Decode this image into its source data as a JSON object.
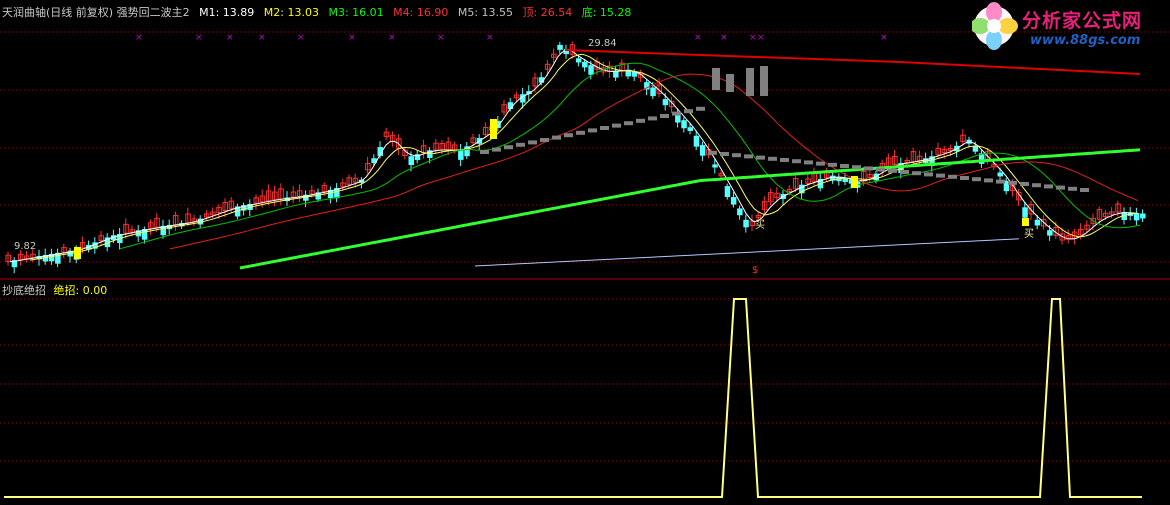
{
  "main_panel": {
    "indicator_name": "天润曲轴(日线 前复权) 强势回二波主2",
    "ma": [
      {
        "label": "M1: 13.89",
        "color": "#ffffff"
      },
      {
        "label": "M2: 13.03",
        "color": "#ffff00"
      },
      {
        "label": "M3: 16.01",
        "color": "#00ff00"
      },
      {
        "label": "M4: 16.90",
        "color": "#ff3030"
      },
      {
        "label": "M5: 13.55",
        "color": "#c0c0c0"
      }
    ],
    "top": {
      "label": "顶: 26.54",
      "color": "#ff3030"
    },
    "bottom": {
      "label": "底: 15.28",
      "color": "#00ff00"
    },
    "high_label": "29.84",
    "low_label": "9.82",
    "buy_label": "买",
    "buy_label_2": "买",
    "marker_label": "$"
  },
  "sub_panel": {
    "indicator_name": "抄底绝招",
    "value_label": "绝招: 0.00"
  },
  "logo": {
    "text": "分析家公式网",
    "url": "www.88gs.com"
  },
  "colors": {
    "grid": "#8b0000",
    "candle_up": "#ff3030",
    "candle_down": "#54ffff",
    "signal": "#ffff80",
    "volume_gray": "#808080",
    "star": "#c000c0"
  }
}
